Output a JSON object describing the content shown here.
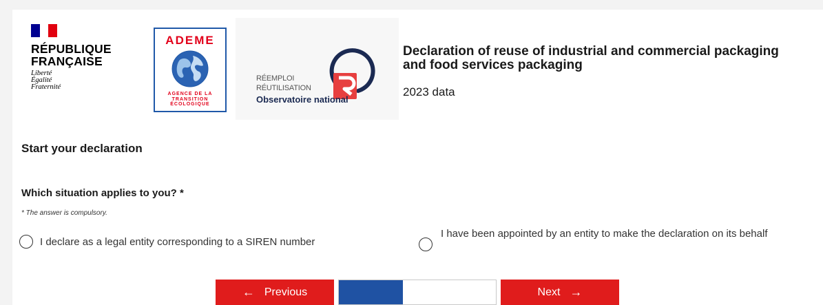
{
  "header": {
    "republique": {
      "name_line1": "RÉPUBLIQUE",
      "name_line2": "FRANÇAISE",
      "motto": [
        "Liberté",
        "Égalité",
        "Fraternité"
      ]
    },
    "ademe": {
      "title": "ADEME",
      "subtitle": [
        "AGENCE DE LA",
        "TRANSITION",
        "ÉCOLOGIQUE"
      ]
    },
    "observatoire": {
      "line1": "Réemploi",
      "line2": "Réutilisation",
      "line3": "Observatoire national"
    },
    "title": "Declaration of reuse of industrial and commercial packaging and food services packaging",
    "subtitle": "2023 data"
  },
  "form": {
    "section_title": "Start your declaration",
    "question": "Which situation applies to you? *",
    "hint": "* The answer is compulsory.",
    "options": [
      {
        "label": "I declare as a legal entity corresponding to a SIREN number"
      },
      {
        "label": "I have been appointed by an entity to make the declaration on its behalf"
      }
    ]
  },
  "navigation": {
    "previous_label": "Previous",
    "next_label": "Next",
    "progress_fraction": 0.41
  },
  "colors": {
    "primary_red": "#e01c1c",
    "progress_blue": "#1f52a3",
    "ademe_blue": "#1f58a8"
  }
}
